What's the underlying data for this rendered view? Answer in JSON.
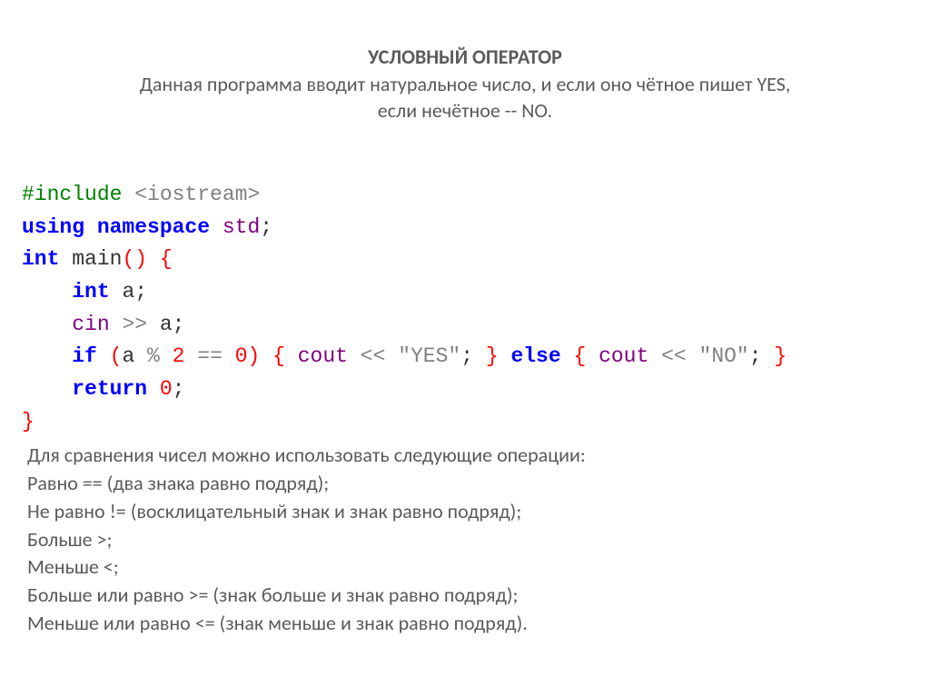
{
  "header": {
    "title": "УСЛОВНЫЙ ОПЕРАТОР",
    "line1": "Данная программа вводит натуральное число, и если оно чётное пишет YES,",
    "line2": "если нечётное -- NO."
  },
  "code": {
    "include_directive": "#include",
    "include_header": " <iostream>",
    "kw_using": "using",
    "kw_namespace": " namespace",
    "std": " std",
    "semicolon1": ";",
    "kw_int": "int",
    "main_name": " main",
    "main_parens": "()",
    "open_brace": " {",
    "indent": "    ",
    "decl_int": "int",
    "decl_var": " a",
    "semicolon2": ";",
    "cin": "cin",
    "cin_op": " >>",
    "cin_var": " a",
    "semicolon3": ";",
    "kw_if": "if",
    "if_cond_open": " (",
    "if_var": "a",
    "if_mod": " % ",
    "if_two": "2",
    "if_eq": " == ",
    "if_zero": "0",
    "if_cond_close": ")",
    "if_body_open": " { ",
    "cout1": "cout",
    "cout1_op": " <<",
    "cout1_str": " \"YES\"",
    "cout1_semi": ";",
    "if_body_close": " }",
    "kw_else": " else",
    "else_body_open": " { ",
    "cout2": "cout",
    "cout2_op": " <<",
    "cout2_str": " \"NO\"",
    "cout2_semi": ";",
    "else_body_close": " }",
    "kw_return": "return",
    "return_val": " 0",
    "semicolon4": ";",
    "close_brace": "}"
  },
  "explain": {
    "l0": "Для сравнения чисел можно использовать следующие операции:",
    "l1": "Равно == (два знака равно подряд);",
    "l2": "Не равно != (восклицательный знак и знак равно подряд);",
    "l3": "Больше >;",
    "l4": "Меньше <;",
    "l5": "Больше или равно >= (знак больше и знак равно подряд);",
    "l6": "Меньше или равно <= (знак меньше и знак равно подряд)."
  }
}
